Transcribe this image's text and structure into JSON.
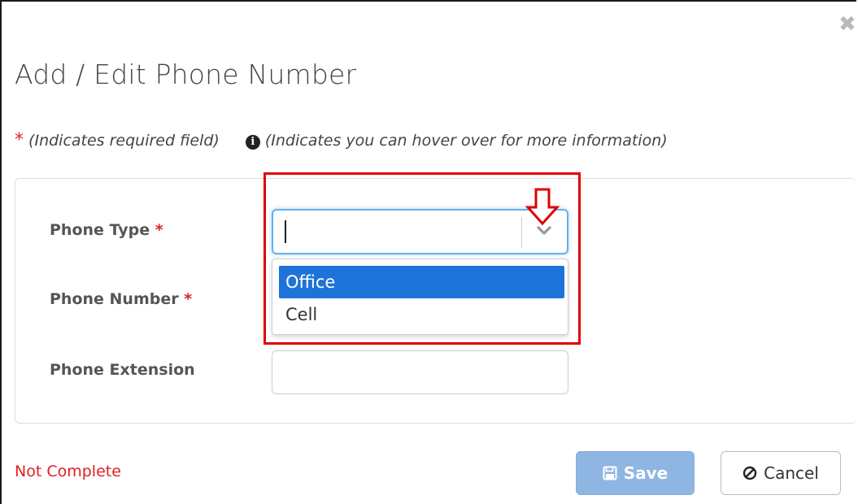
{
  "dialog": {
    "title": "Add / Edit Phone Number",
    "close_icon": "close-icon"
  },
  "legend": {
    "required_star": "*",
    "required_text": "(Indicates required field)",
    "info_glyph": "i",
    "info_text": "(Indicates you can hover over for more information)"
  },
  "form": {
    "phone_type_label": "Phone Type",
    "phone_number_label": "Phone Number",
    "phone_extension_label": "Phone Extension",
    "required_marker": "*",
    "phone_type_value": "",
    "phone_type_options": [
      "Office",
      "Cell"
    ],
    "phone_type_highlighted": "Office",
    "phone_extension_value": ""
  },
  "footer": {
    "status": "Not Complete",
    "save_label": "Save",
    "cancel_label": "Cancel",
    "save_icon": "floppy-disk-icon",
    "cancel_icon": "ban-icon"
  },
  "colors": {
    "required": "#dd2222",
    "highlight_box": "#e00000",
    "option_selected": "#1e73d8",
    "save_button": "#8fb6e3",
    "status_text": "#e02020"
  }
}
